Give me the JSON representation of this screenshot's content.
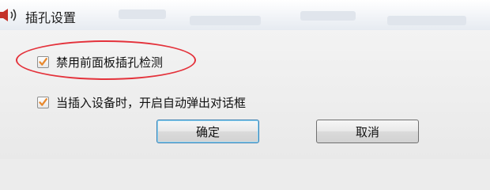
{
  "window": {
    "title": "插孔设置",
    "icon": "speaker-icon"
  },
  "options": [
    {
      "label": "禁用前面板插孔检测",
      "checked": true
    },
    {
      "label": "当插入设备时，开启自动弹出对话框",
      "checked": true
    }
  ],
  "buttons": {
    "ok_label": "确定",
    "cancel_label": "取消"
  },
  "colors": {
    "annotation_circle": "#e4323b",
    "checkmark": "#e8892e",
    "default_button_border": "#3c7fb1"
  }
}
